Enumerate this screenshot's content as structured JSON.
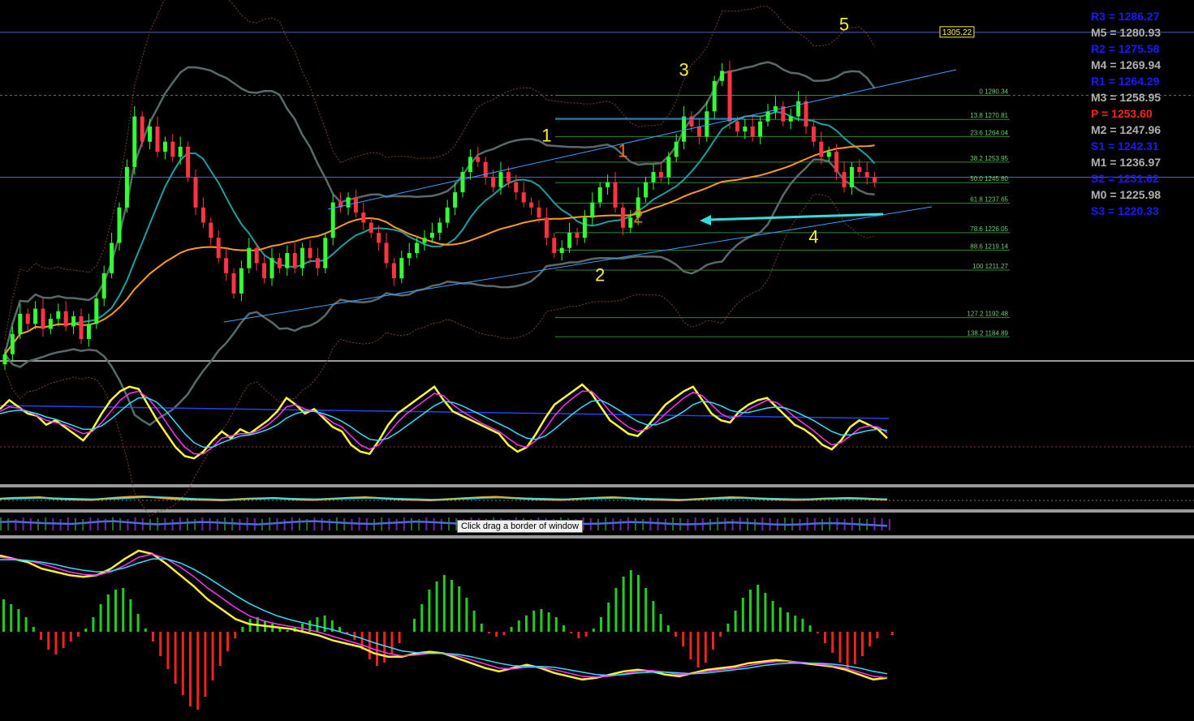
{
  "colors": {
    "background": "#000000",
    "bull_candle": "#33ff33",
    "bear_candle": "#ff3344",
    "wave_label": "#ffee33",
    "alt_wave_label": "#ff6a1a",
    "fib_line": "#2e8b2e",
    "fib_text": "#6fcf6f",
    "trendline": "#3aa0ff",
    "ma_orange": "#ff9922",
    "ma_teal": "#1fa0a0",
    "band_gray": "#5a6a6a",
    "pivot_r": "#1a1aff",
    "pivot_m": "#b0b0b0",
    "pivot_p": "#ff2222",
    "cyan_arrow": "#33dddd",
    "hist_up": "#22cc22",
    "hist_down": "#ee2222"
  },
  "pivots": [
    {
      "label": "R3 = 1286.27",
      "kind": "r"
    },
    {
      "label": "M5 = 1280.93",
      "kind": "m"
    },
    {
      "label": "R2 = 1275.58",
      "kind": "r"
    },
    {
      "label": "M4 = 1269.94",
      "kind": "m"
    },
    {
      "label": "R1 = 1264.29",
      "kind": "r"
    },
    {
      "label": "M3 = 1258.95",
      "kind": "m"
    },
    {
      "label": "P  = 1253.60",
      "kind": "p"
    },
    {
      "label": "M2 = 1247.96",
      "kind": "m"
    },
    {
      "label": "S1 = 1242.31",
      "kind": "r"
    },
    {
      "label": "M1 = 1236.97",
      "kind": "m"
    },
    {
      "label": "S2 = 1231.62",
      "kind": "r"
    },
    {
      "label": "M0 = 1225.98",
      "kind": "m"
    },
    {
      "label": "S3 = 1220.33",
      "kind": "r"
    }
  ],
  "price_marker": "1305.22",
  "tooltip": "Click  drag a border of window",
  "chart_data": [
    {
      "type": "candlestick",
      "pane": "main",
      "y_range": [
        1176,
        1318
      ],
      "fib_levels": [
        {
          "label": "0 1280.34",
          "value": 1280.34
        },
        {
          "label": "13.8 1270.81",
          "value": 1270.81
        },
        {
          "label": "23.6 1264.04",
          "value": 1264.04
        },
        {
          "label": "38.2 1253.95",
          "value": 1253.95
        },
        {
          "label": "50.0 1245.80",
          "value": 1245.8
        },
        {
          "label": "61.8 1237.65",
          "value": 1237.65
        },
        {
          "label": "78.6 1226.05",
          "value": 1226.05
        },
        {
          "label": "88.6 1219.14",
          "value": 1219.14
        },
        {
          "label": "100 1211.27",
          "value": 1211.27
        },
        {
          "label": "127.2 1192.48",
          "value": 1192.48
        },
        {
          "label": "138.2 1184.89",
          "value": 1184.89
        }
      ],
      "horizontal_lines": [
        {
          "value": 1305.22,
          "style": "solid"
        },
        {
          "value": 1280.34,
          "style": "dashed"
        },
        {
          "value": 1247.96,
          "style": "solid"
        }
      ],
      "wave_labels": [
        {
          "text": "1",
          "value": 1262,
          "bar": 71,
          "alt": false
        },
        {
          "text": "2",
          "value": 1207,
          "bar": 78,
          "alt": false
        },
        {
          "text": "3",
          "value": 1288,
          "bar": 89,
          "alt": false
        },
        {
          "text": "4",
          "value": 1222,
          "bar": 106,
          "alt": false
        },
        {
          "text": "5",
          "value": 1306,
          "bar": 110,
          "alt": false
        },
        {
          "text": "1",
          "value": 1256,
          "bar": 81,
          "alt": true
        },
        {
          "text": "2",
          "value": 1230,
          "bar": 83,
          "alt": true
        }
      ],
      "closes": [
        1178,
        1186,
        1194,
        1190,
        1196,
        1188,
        1192,
        1195,
        1189,
        1193,
        1184,
        1190,
        1200,
        1210,
        1222,
        1236,
        1252,
        1272,
        1262,
        1268,
        1258,
        1262,
        1256,
        1260,
        1248,
        1236,
        1230,
        1224,
        1216,
        1210,
        1202,
        1212,
        1220,
        1214,
        1208,
        1216,
        1212,
        1218,
        1212,
        1220,
        1216,
        1212,
        1224,
        1238,
        1236,
        1240,
        1234,
        1230,
        1226,
        1222,
        1214,
        1208,
        1216,
        1218,
        1222,
        1224,
        1226,
        1230,
        1236,
        1242,
        1250,
        1256,
        1254,
        1248,
        1244,
        1250,
        1246,
        1242,
        1238,
        1236,
        1232,
        1224,
        1218,
        1220,
        1226,
        1224,
        1232,
        1238,
        1244,
        1246,
        1236,
        1228,
        1232,
        1240,
        1246,
        1250,
        1248,
        1256,
        1262,
        1272,
        1268,
        1264,
        1274,
        1286,
        1290,
        1270,
        1266,
        1268,
        1264,
        1270,
        1274,
        1276,
        1270,
        1272,
        1278,
        1268,
        1262,
        1256,
        1258,
        1250,
        1244,
        1252,
        1250,
        1248,
        1246
      ]
    },
    {
      "type": "line",
      "pane": "oscillator-1",
      "y_range": [
        0,
        100
      ],
      "series": [
        {
          "color": "#ffff33",
          "values": [
            62,
            70,
            64,
            58,
            56,
            48,
            52,
            46,
            40,
            34,
            44,
            58,
            70,
            78,
            82,
            80,
            66,
            52,
            40,
            28,
            20,
            18,
            24,
            34,
            42,
            36,
            44,
            40,
            46,
            52,
            60,
            72,
            66,
            58,
            62,
            54,
            46,
            42,
            30,
            24,
            22,
            34,
            48,
            58,
            64,
            70,
            76,
            82,
            70,
            60,
            56,
            52,
            48,
            44,
            40,
            30,
            24,
            28,
            40,
            54,
            66,
            72,
            78,
            84,
            76,
            64,
            52,
            46,
            40,
            38,
            46,
            56,
            66,
            72,
            78,
            82,
            70,
            58,
            52,
            50,
            60,
            66,
            70,
            72,
            64,
            56,
            48,
            44,
            38,
            30,
            26,
            34,
            46,
            52,
            48,
            44,
            36
          ]
        },
        {
          "color": "#ff33ff",
          "values": [
            60,
            64,
            63,
            60,
            56,
            52,
            50,
            48,
            44,
            40,
            42,
            50,
            60,
            70,
            76,
            78,
            72,
            62,
            50,
            38,
            28,
            22,
            22,
            28,
            36,
            38,
            40,
            40,
            43,
            48,
            55,
            64,
            66,
            62,
            60,
            56,
            50,
            46,
            38,
            30,
            26,
            30,
            40,
            50,
            58,
            64,
            70,
            76,
            74,
            66,
            60,
            55,
            50,
            46,
            42,
            36,
            30,
            28,
            34,
            44,
            56,
            65,
            72,
            78,
            78,
            70,
            60,
            52,
            46,
            42,
            44,
            50,
            58,
            65,
            72,
            77,
            74,
            66,
            58,
            54,
            56,
            62,
            66,
            70,
            68,
            62,
            55,
            49,
            43,
            36,
            30,
            32,
            38,
            45,
            47,
            46,
            41
          ]
        },
        {
          "color": "#33ddff",
          "values": [
            58,
            60,
            61,
            60,
            58,
            55,
            53,
            50,
            47,
            44,
            44,
            47,
            53,
            60,
            67,
            72,
            72,
            68,
            60,
            50,
            40,
            32,
            28,
            28,
            32,
            35,
            38,
            39,
            41,
            44,
            48,
            54,
            58,
            60,
            60,
            58,
            55,
            51,
            46,
            40,
            35,
            34,
            36,
            41,
            47,
            53,
            59,
            65,
            69,
            68,
            65,
            61,
            57,
            53,
            49,
            45,
            40,
            36,
            35,
            38,
            44,
            51,
            58,
            64,
            69,
            70,
            66,
            61,
            56,
            51,
            48,
            48,
            51,
            55,
            60,
            66,
            69,
            68,
            65,
            61,
            59,
            59,
            61,
            63,
            64,
            63,
            60,
            56,
            52,
            47,
            42,
            39,
            39,
            41,
            43,
            44,
            43
          ]
        }
      ]
    },
    {
      "type": "line",
      "pane": "oscillator-2",
      "y_range": [
        0,
        100
      ],
      "series": [
        {
          "color": "#ffaa22",
          "values": [
            50,
            54,
            56,
            58,
            52,
            48,
            46,
            44,
            50,
            56,
            60,
            62,
            58,
            52,
            48,
            46,
            44,
            42,
            46,
            50,
            52,
            54,
            50,
            46,
            44,
            48,
            52,
            56,
            58,
            54,
            50,
            46,
            44,
            42,
            46,
            50,
            54,
            58,
            60,
            56,
            52,
            48,
            46,
            44,
            48,
            52,
            56,
            58,
            54,
            50,
            46,
            44,
            42,
            46,
            50,
            54,
            58,
            56,
            52,
            48,
            46,
            44,
            46,
            50,
            52,
            54,
            52,
            48,
            46
          ]
        },
        {
          "color": "#33dddd",
          "values": [
            48,
            50,
            52,
            54,
            54,
            52,
            50,
            48,
            48,
            50,
            54,
            58,
            60,
            58,
            54,
            50,
            48,
            46,
            46,
            48,
            50,
            52,
            52,
            50,
            48,
            48,
            50,
            52,
            54,
            54,
            52,
            50,
            48,
            46,
            46,
            48,
            50,
            54,
            56,
            56,
            54,
            52,
            50,
            48,
            48,
            50,
            52,
            54,
            54,
            52,
            50,
            48,
            46,
            46,
            48,
            50,
            52,
            54,
            54,
            52,
            50,
            48,
            48,
            48,
            50,
            50,
            50,
            48,
            48
          ]
        }
      ]
    },
    {
      "type": "line",
      "pane": "oscillator-3",
      "y_range": [
        0,
        100
      ],
      "series": [
        {
          "color": "#4a6adf",
          "values": [
            60,
            62,
            58,
            54,
            52,
            50,
            56,
            62,
            64,
            58,
            52,
            48,
            52,
            56,
            60,
            58,
            54,
            50,
            48,
            52,
            58,
            62,
            64,
            60,
            56,
            52,
            50,
            54,
            58,
            62,
            60,
            56,
            52,
            48,
            50,
            56,
            60,
            64,
            62,
            58,
            54,
            50,
            52,
            56,
            60,
            58,
            54,
            50,
            48,
            50,
            54,
            58,
            56,
            52,
            48,
            46,
            48,
            52,
            54,
            52,
            48,
            44,
            40
          ]
        }
      ]
    },
    {
      "type": "bar",
      "pane": "macd-histogram",
      "y_range": [
        -100,
        100
      ],
      "values": [
        40,
        34,
        28,
        18,
        6,
        -10,
        -22,
        -28,
        -20,
        -12,
        -6,
        4,
        18,
        34,
        46,
        52,
        54,
        40,
        22,
        4,
        -12,
        -30,
        -46,
        -64,
        -78,
        -92,
        -96,
        -80,
        -60,
        -42,
        -24,
        -8,
        6,
        16,
        18,
        14,
        10,
        6,
        2,
        6,
        10,
        14,
        18,
        20,
        14,
        6,
        -2,
        -10,
        -22,
        -34,
        -42,
        -38,
        -28,
        -14,
        0,
        16,
        34,
        52,
        62,
        70,
        64,
        56,
        42,
        26,
        10,
        -2,
        -6,
        -4,
        6,
        14,
        20,
        26,
        28,
        24,
        18,
        8,
        -2,
        -8,
        -6,
        4,
        18,
        36,
        54,
        68,
        76,
        70,
        54,
        38,
        22,
        8,
        -6,
        -18,
        -34,
        -44,
        -38,
        -22,
        -6,
        10,
        26,
        42,
        52,
        58,
        48,
        38,
        30,
        24,
        20,
        16,
        8,
        -2,
        -14,
        -26,
        -38,
        -46,
        -40,
        -30,
        -18,
        -8,
        0,
        -4
      ]
    },
    {
      "type": "line",
      "pane": "macd-lines",
      "y_range": [
        -100,
        100
      ],
      "series": [
        {
          "color": "#ffee33",
          "values": [
            90,
            86,
            82,
            74,
            70,
            66,
            64,
            66,
            74,
            86,
            96,
            92,
            80,
            66,
            52,
            36,
            24,
            12,
            6,
            4,
            2,
            0,
            -4,
            -8,
            -14,
            -18,
            -22,
            -30,
            -34,
            -34,
            -30,
            -28,
            -30,
            -36,
            -42,
            -48,
            -52,
            -48,
            -44,
            -48,
            -54,
            -58,
            -62,
            -60,
            -56,
            -52,
            -50,
            -52,
            -56,
            -58,
            -54,
            -50,
            -48,
            -46,
            -42,
            -40,
            -38,
            -40,
            -42,
            -44,
            -46,
            -50,
            -56,
            -62,
            -60
          ]
        },
        {
          "color": "#ff33ff",
          "values": [
            88,
            86,
            84,
            80,
            75,
            70,
            67,
            66,
            70,
            78,
            88,
            92,
            86,
            76,
            64,
            50,
            38,
            26,
            16,
            10,
            6,
            3,
            0,
            -4,
            -9,
            -14,
            -19,
            -25,
            -30,
            -33,
            -32,
            -30,
            -30,
            -33,
            -38,
            -43,
            -48,
            -49,
            -47,
            -47,
            -50,
            -54,
            -58,
            -59,
            -58,
            -55,
            -52,
            -51,
            -53,
            -56,
            -55,
            -52,
            -50,
            -48,
            -45,
            -42,
            -40,
            -40,
            -41,
            -43,
            -45,
            -48,
            -53,
            -58,
            -60
          ]
        },
        {
          "color": "#33ddff",
          "values": [
            85,
            85,
            84,
            82,
            79,
            75,
            72,
            70,
            71,
            75,
            81,
            86,
            86,
            81,
            73,
            63,
            52,
            41,
            31,
            23,
            16,
            11,
            7,
            3,
            -1,
            -6,
            -11,
            -17,
            -22,
            -27,
            -29,
            -30,
            -30,
            -31,
            -34,
            -38,
            -42,
            -45,
            -46,
            -46,
            -47,
            -50,
            -53,
            -56,
            -57,
            -56,
            -54,
            -53,
            -53,
            -54,
            -55,
            -54,
            -52,
            -50,
            -48,
            -45,
            -43,
            -42,
            -42,
            -42,
            -43,
            -45,
            -48,
            -52,
            -55
          ]
        }
      ]
    }
  ]
}
